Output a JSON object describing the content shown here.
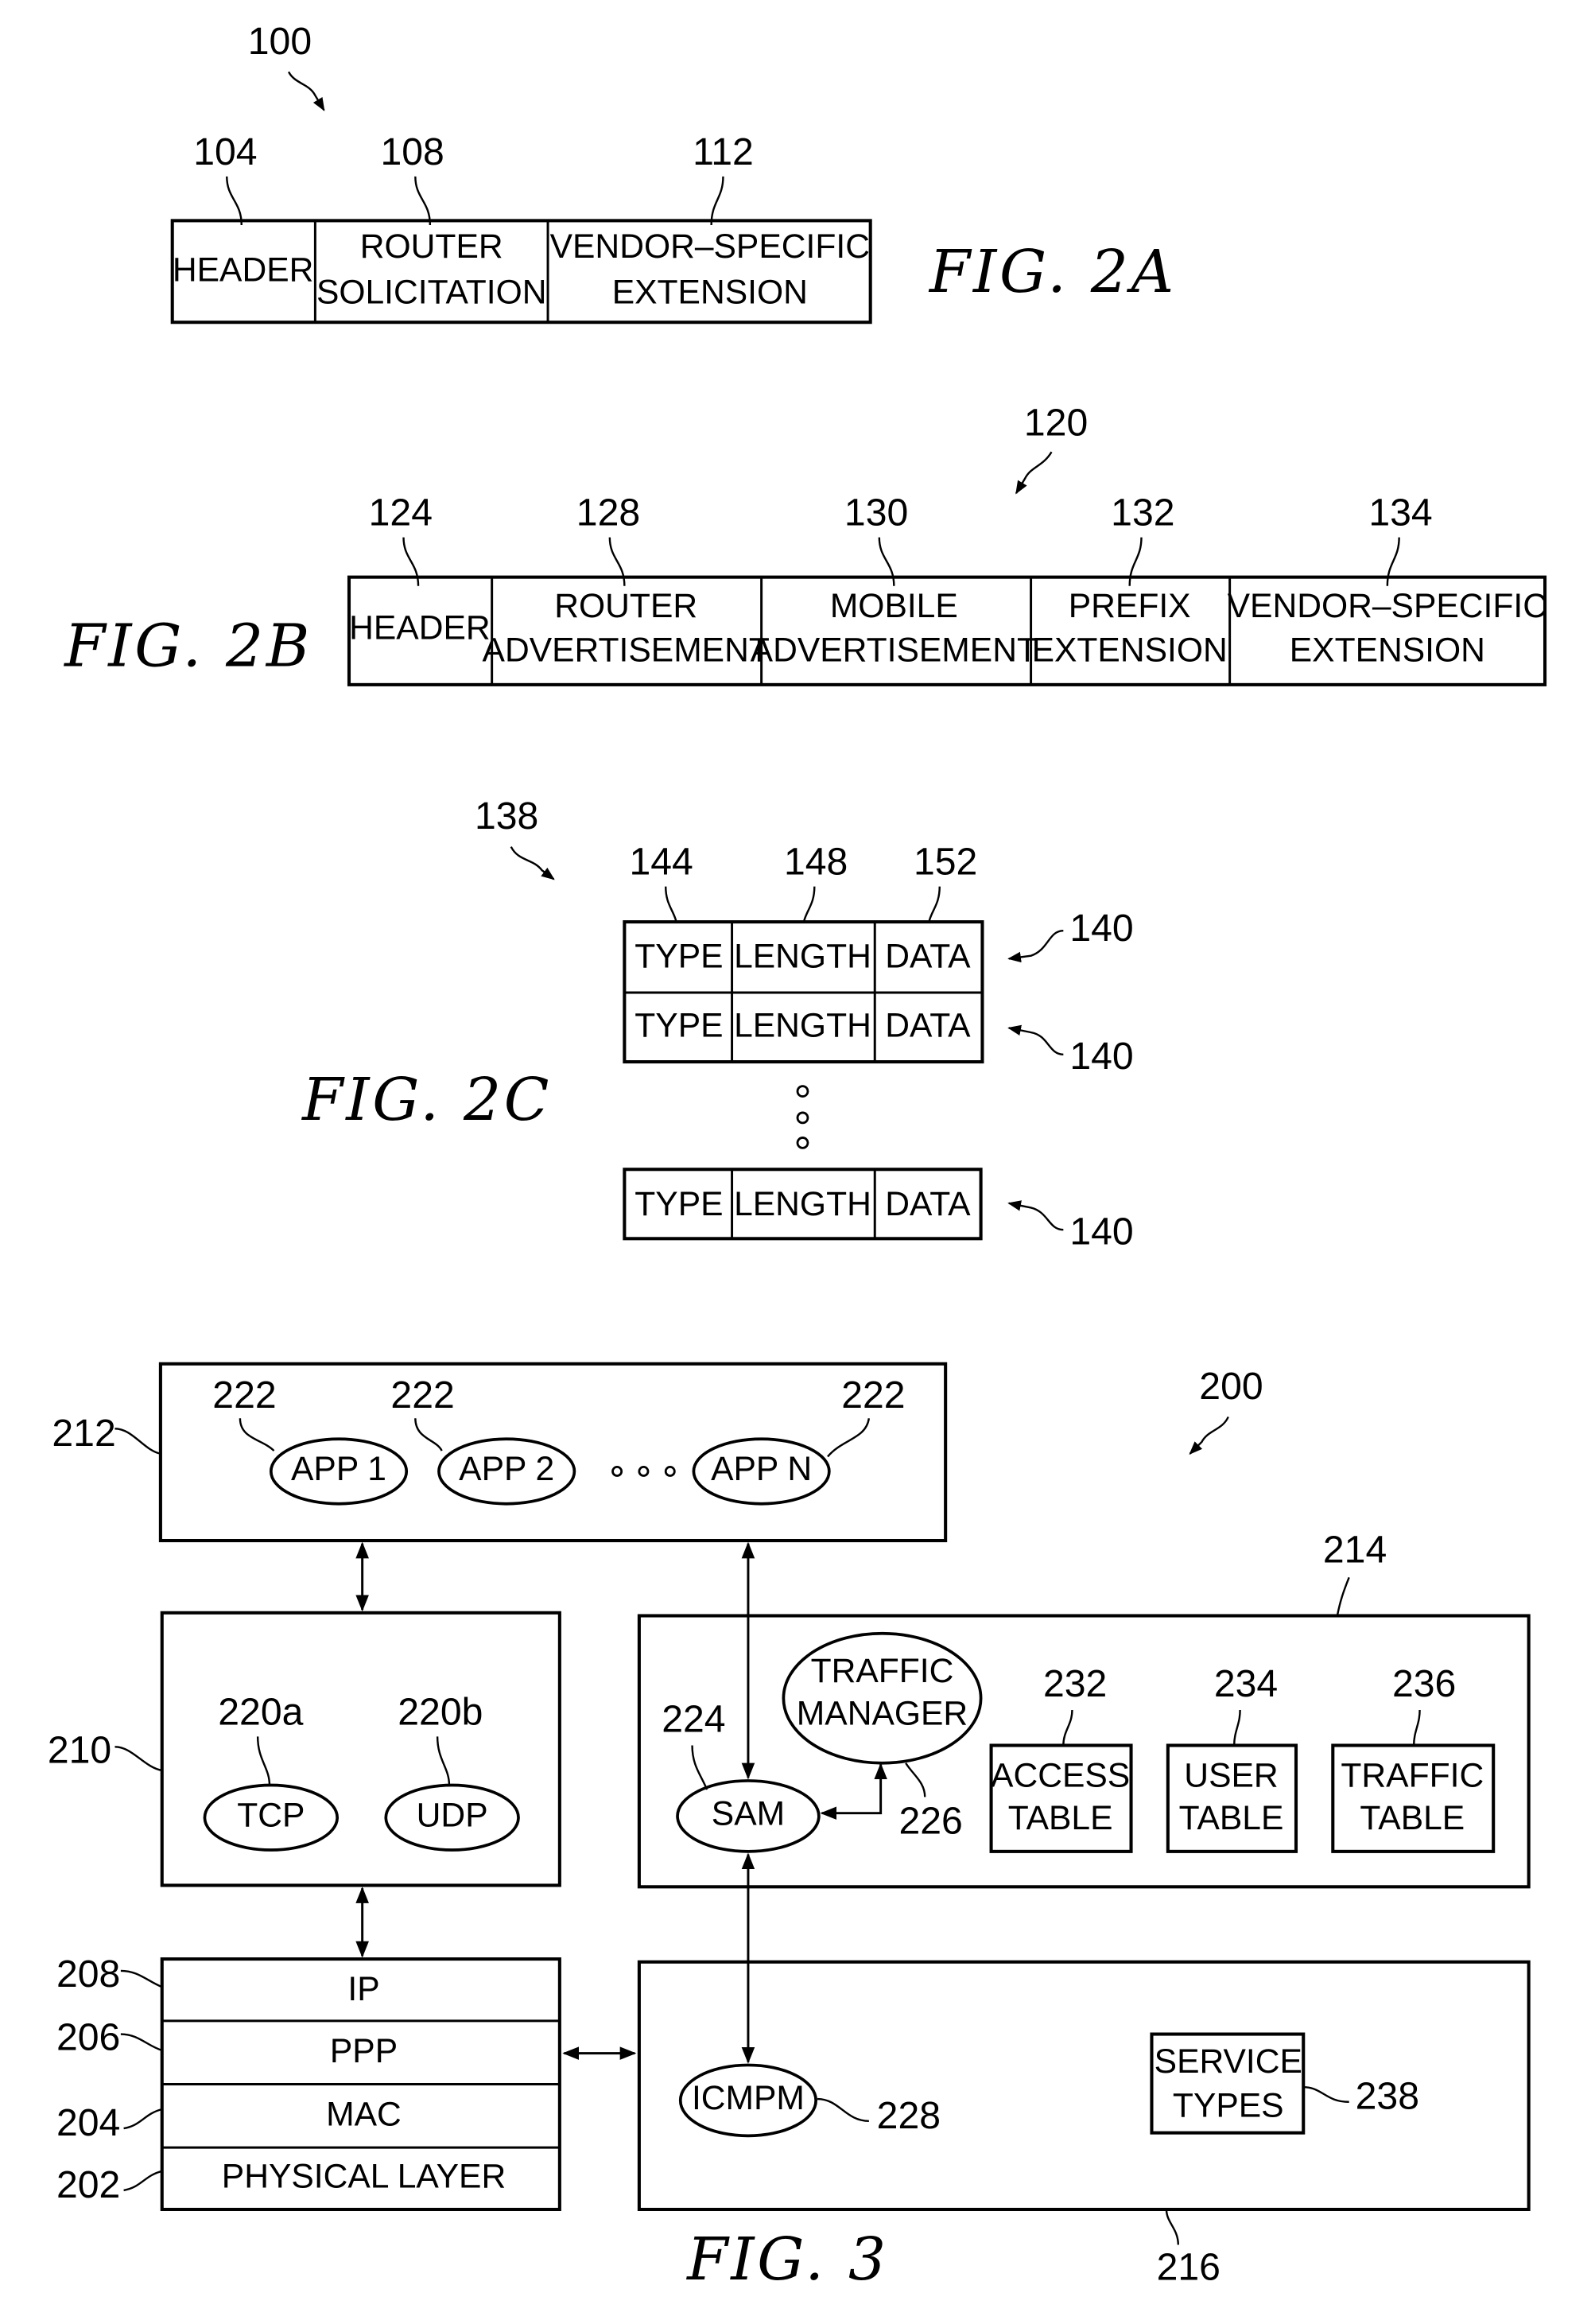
{
  "fig2a": {
    "caption": "FIG.  2A",
    "ref": "100",
    "fields": [
      {
        "ref": "104",
        "lines": [
          "HEADER"
        ]
      },
      {
        "ref": "108",
        "lines": [
          "ROUTER",
          "SOLICITATION"
        ]
      },
      {
        "ref": "112",
        "lines": [
          "VENDOR–SPECIFIC",
          "EXTENSION"
        ]
      }
    ]
  },
  "fig2b": {
    "caption": "FIG.  2B",
    "ref": "120",
    "fields": [
      {
        "ref": "124",
        "lines": [
          "HEADER"
        ]
      },
      {
        "ref": "128",
        "lines": [
          "ROUTER",
          "ADVERTISEMENT"
        ]
      },
      {
        "ref": "130",
        "lines": [
          "MOBILE",
          "ADVERTISEMENT"
        ]
      },
      {
        "ref": "132",
        "lines": [
          "PREFIX",
          "EXTENSION"
        ]
      },
      {
        "ref": "134",
        "lines": [
          "VENDOR–SPECIFIC",
          "EXTENSION"
        ]
      }
    ]
  },
  "fig2c": {
    "caption": "FIG.  2C",
    "ref": "138",
    "column_refs": [
      "144",
      "148",
      "152"
    ],
    "row_ref": "140",
    "rows": [
      [
        "TYPE",
        "LENGTH",
        "DATA"
      ],
      [
        "TYPE",
        "LENGTH",
        "DATA"
      ],
      [
        "TYPE",
        "LENGTH",
        "DATA"
      ]
    ]
  },
  "fig3": {
    "caption": "FIG.  3",
    "ref": "200",
    "app_layer": {
      "ref": "212",
      "apps": [
        {
          "ref": "222",
          "label": "APP  1"
        },
        {
          "ref": "222",
          "label": "APP  2"
        },
        {
          "ref": "222",
          "label": "APP  N"
        }
      ]
    },
    "transport": {
      "ref": "210",
      "protocols": [
        {
          "ref": "220a",
          "label": "TCP"
        },
        {
          "ref": "220b",
          "label": "UDP"
        }
      ]
    },
    "stack": [
      {
        "ref": "208",
        "label": "IP"
      },
      {
        "ref": "206",
        "label": "PPP"
      },
      {
        "ref": "204",
        "label": "MAC"
      },
      {
        "ref": "202",
        "label": "PHYSICAL  LAYER"
      }
    ],
    "manager_block": {
      "ref": "214",
      "sam": {
        "ref": "224",
        "label": "SAM"
      },
      "traffic_manager": {
        "ref": "226",
        "lines": [
          "TRAFFIC",
          "MANAGER"
        ]
      },
      "tables": [
        {
          "ref": "232",
          "lines": [
            "ACCESS",
            "TABLE"
          ]
        },
        {
          "ref": "234",
          "lines": [
            "USER",
            "TABLE"
          ]
        },
        {
          "ref": "236",
          "lines": [
            "TRAFFIC",
            "TABLE"
          ]
        }
      ]
    },
    "icmp_block": {
      "ref": "216",
      "icmpm": {
        "ref": "228",
        "label": "ICMPM"
      },
      "service_types": {
        "ref": "238",
        "lines": [
          "SERVICE",
          "TYPES"
        ]
      }
    }
  }
}
